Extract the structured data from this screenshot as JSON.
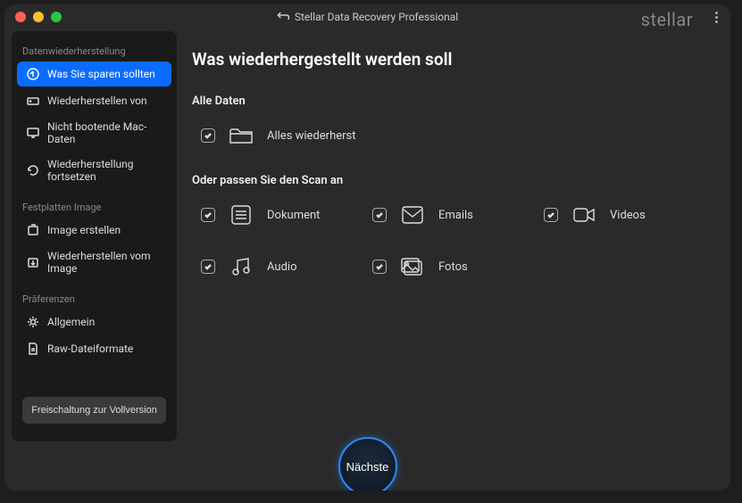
{
  "app_title": "Stellar Data Recovery Professional",
  "brand": "stellar",
  "sidebar": {
    "sections": [
      {
        "title": "Datenwiederherstellung",
        "items": [
          {
            "label": "Was Sie sparen sollten",
            "icon": "restore-icon",
            "active": true
          },
          {
            "label": "Wiederherstellen von",
            "icon": "drive-icon",
            "active": false
          },
          {
            "label": "Nicht bootende Mac-Daten",
            "icon": "monitor-icon",
            "active": false
          },
          {
            "label": "Wiederherstellung fortsetzen",
            "icon": "resume-icon",
            "active": false
          }
        ]
      },
      {
        "title": "Festplatten Image",
        "items": [
          {
            "label": "Image erstellen",
            "icon": "create-image-icon",
            "active": false
          },
          {
            "label": "Wiederherstellen vom Image",
            "icon": "restore-image-icon",
            "active": false
          }
        ]
      },
      {
        "title": "Präferenzen",
        "items": [
          {
            "label": "Allgemein",
            "icon": "gear-icon",
            "active": false
          },
          {
            "label": "Raw-Dateiformate",
            "icon": "raw-file-icon",
            "active": false
          }
        ]
      }
    ],
    "unlock_label": "Freischaltung zur Vollversion"
  },
  "main": {
    "heading": "Was wiederhergestellt werden soll",
    "all_data_label": "Alle Daten",
    "all_option": {
      "label": "Alles wiederherst",
      "checked": true
    },
    "customize_label": "Oder passen Sie den Scan an",
    "options_row1": [
      {
        "key": "document",
        "label": "Dokument",
        "checked": true
      },
      {
        "key": "emails",
        "label": "Emails",
        "checked": true
      },
      {
        "key": "videos",
        "label": "Videos",
        "checked": true
      }
    ],
    "options_row2": [
      {
        "key": "audio",
        "label": "Audio",
        "checked": true
      },
      {
        "key": "photos",
        "label": "Fotos",
        "checked": true
      }
    ],
    "next_label": "Nächste"
  }
}
